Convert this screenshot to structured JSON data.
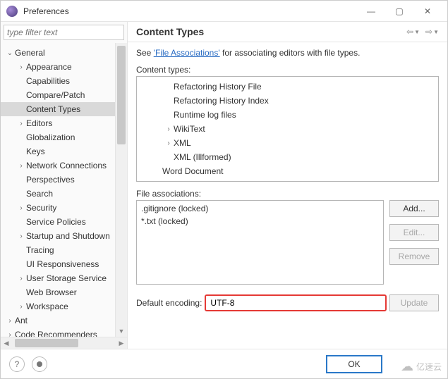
{
  "window": {
    "title": "Preferences",
    "min_icon": "—",
    "max_icon": "▢",
    "close_icon": "✕"
  },
  "filter": {
    "placeholder": "type filter text"
  },
  "tree": [
    {
      "label": "General",
      "depth": 0,
      "arrow": "v",
      "sel": false
    },
    {
      "label": "Appearance",
      "depth": 1,
      "arrow": ">",
      "sel": false
    },
    {
      "label": "Capabilities",
      "depth": 1,
      "arrow": "",
      "sel": false
    },
    {
      "label": "Compare/Patch",
      "depth": 1,
      "arrow": "",
      "sel": false
    },
    {
      "label": "Content Types",
      "depth": 1,
      "arrow": "",
      "sel": true
    },
    {
      "label": "Editors",
      "depth": 1,
      "arrow": ">",
      "sel": false
    },
    {
      "label": "Globalization",
      "depth": 1,
      "arrow": "",
      "sel": false
    },
    {
      "label": "Keys",
      "depth": 1,
      "arrow": "",
      "sel": false
    },
    {
      "label": "Network Connections",
      "depth": 1,
      "arrow": ">",
      "sel": false
    },
    {
      "label": "Perspectives",
      "depth": 1,
      "arrow": "",
      "sel": false
    },
    {
      "label": "Search",
      "depth": 1,
      "arrow": "",
      "sel": false
    },
    {
      "label": "Security",
      "depth": 1,
      "arrow": ">",
      "sel": false
    },
    {
      "label": "Service Policies",
      "depth": 1,
      "arrow": "",
      "sel": false
    },
    {
      "label": "Startup and Shutdown",
      "depth": 1,
      "arrow": ">",
      "sel": false
    },
    {
      "label": "Tracing",
      "depth": 1,
      "arrow": "",
      "sel": false
    },
    {
      "label": "UI Responsiveness",
      "depth": 1,
      "arrow": "",
      "sel": false
    },
    {
      "label": "User Storage Service",
      "depth": 1,
      "arrow": ">",
      "sel": false
    },
    {
      "label": "Web Browser",
      "depth": 1,
      "arrow": "",
      "sel": false
    },
    {
      "label": "Workspace",
      "depth": 1,
      "arrow": ">",
      "sel": false
    },
    {
      "label": "Ant",
      "depth": 0,
      "arrow": ">",
      "sel": false
    },
    {
      "label": "Code Recommenders",
      "depth": 0,
      "arrow": ">",
      "sel": false
    }
  ],
  "panel": {
    "title": "Content Types",
    "desc_prefix": "See ",
    "desc_link": "'File Associations'",
    "desc_suffix": " for associating editors with file types.",
    "ct_label": "Content types:",
    "fa_label": "File associations:",
    "enc_label": "Default encoding:",
    "enc_value": "UTF-8"
  },
  "content_types": [
    {
      "label": "Refactoring History File",
      "depth": 2,
      "arrow": ""
    },
    {
      "label": "Refactoring History Index",
      "depth": 2,
      "arrow": ""
    },
    {
      "label": "Runtime log files",
      "depth": 2,
      "arrow": ""
    },
    {
      "label": "WikiText",
      "depth": 2,
      "arrow": ">"
    },
    {
      "label": "XML",
      "depth": 2,
      "arrow": ">"
    },
    {
      "label": "XML (Illformed)",
      "depth": 2,
      "arrow": ""
    },
    {
      "label": "Word Document",
      "depth": 1,
      "arrow": ""
    }
  ],
  "file_assoc": [
    ".gitignore (locked)",
    "*.txt (locked)"
  ],
  "buttons": {
    "add": "Add...",
    "edit": "Edit...",
    "remove": "Remove",
    "update": "Update",
    "ok": "OK"
  },
  "watermark": "亿速云"
}
